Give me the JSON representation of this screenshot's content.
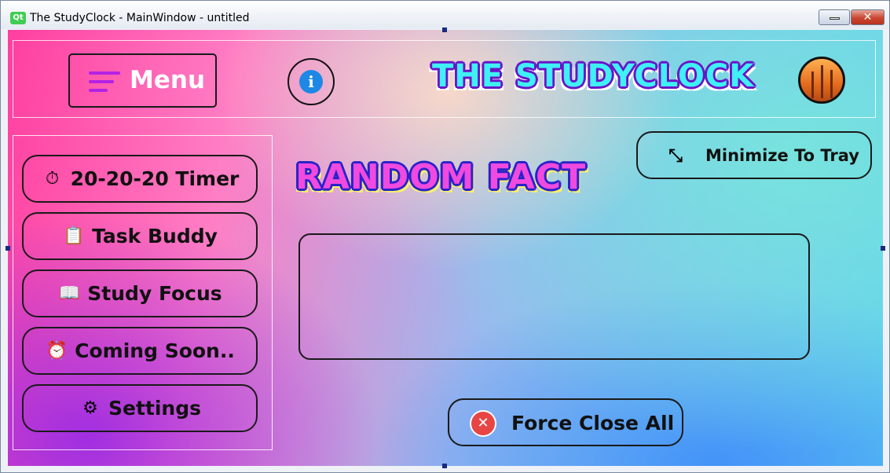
{
  "window": {
    "title": "The StudyClock - MainWindow - untitled",
    "app_icon": "Qt",
    "minimize_label": "",
    "close_label": "✕"
  },
  "header": {
    "menu_label": "Menu",
    "app_title": "THE STUDYCLOCK",
    "info_glyph": "i"
  },
  "sidebar": {
    "items": [
      {
        "label": "20-20-20 Timer",
        "icon": "stopwatch-icon",
        "glyph": "⏱"
      },
      {
        "label": "Task Buddy",
        "icon": "task-checklist-icon",
        "glyph": "📋"
      },
      {
        "label": "Study Focus",
        "icon": "reading-student-icon",
        "glyph": "📖"
      },
      {
        "label": "Coming Soon..",
        "icon": "alarm-clock-icon",
        "glyph": "⏰"
      },
      {
        "label": "Settings",
        "icon": "gear-icon",
        "glyph": "⚙"
      }
    ]
  },
  "main": {
    "section_title": "RANDOM FACT",
    "fact_text": "",
    "minimize_to_tray_label": "Minimize To Tray",
    "minimize_glyph": "⤡",
    "force_close_label": "Force Close All",
    "force_close_glyph": "✕"
  },
  "colors": {
    "title_fill": "#3ff0f5",
    "title_outline": "#6a14c8",
    "random_fill": "#f04adf",
    "random_outline": "#2a22c9",
    "hamburger": "#b321e6",
    "danger": "#e84545",
    "info": "#1e88e5"
  }
}
